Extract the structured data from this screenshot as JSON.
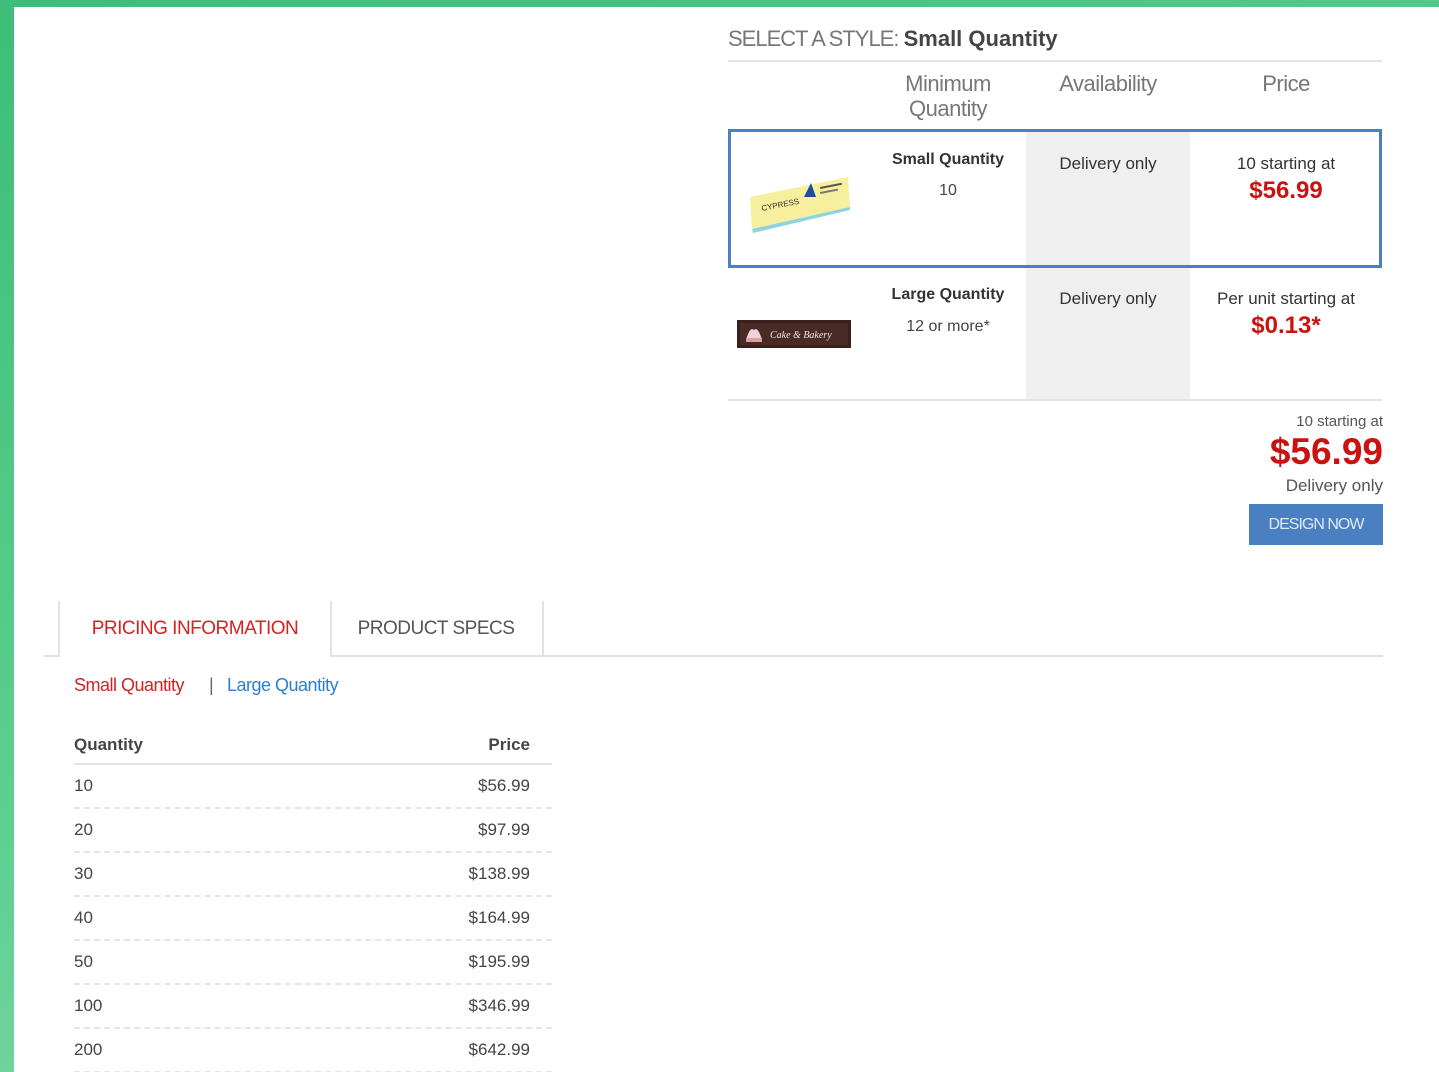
{
  "selector": {
    "heading_prefix": "SELECT A STYLE:",
    "heading_value": "Small Quantity",
    "columns": {
      "min_qty_line1": "Minimum",
      "min_qty_line2": "Quantity",
      "availability": "Availability",
      "price": "Price"
    },
    "options": [
      {
        "name": "Small Quantity",
        "min": "10",
        "availability": "Delivery only",
        "price_label": "10 starting at",
        "price": "$56.99",
        "selected": true
      },
      {
        "name": "Large Quantity",
        "min": "12 or more*",
        "availability": "Delivery only",
        "price_label": "Per unit starting at",
        "price": "$0.13*",
        "selected": false
      }
    ]
  },
  "summary": {
    "label": "10 starting at",
    "price": "$56.99",
    "availability": "Delivery only",
    "button": "DESIGN NOW"
  },
  "tabs": [
    {
      "label": "PRICING INFORMATION",
      "active": true
    },
    {
      "label": "PRODUCT SPECS",
      "active": false
    }
  ],
  "subtabs": {
    "small": "Small Quantity",
    "separator": "|",
    "large": "Large Quantity"
  },
  "price_table": {
    "headers": {
      "quantity": "Quantity",
      "price": "Price"
    },
    "rows": [
      {
        "qty": "10",
        "price": "$56.99"
      },
      {
        "qty": "20",
        "price": "$97.99"
      },
      {
        "qty": "30",
        "price": "$138.99"
      },
      {
        "qty": "40",
        "price": "$164.99"
      },
      {
        "qty": "50",
        "price": "$195.99"
      },
      {
        "qty": "100",
        "price": "$346.99"
      },
      {
        "qty": "200",
        "price": "$642.99"
      }
    ]
  },
  "colors": {
    "accent_red": "#cc1111",
    "accent_blue": "#4a7fc1",
    "link_blue": "#2a7fd4",
    "frame_green": "#3dbd7a"
  }
}
